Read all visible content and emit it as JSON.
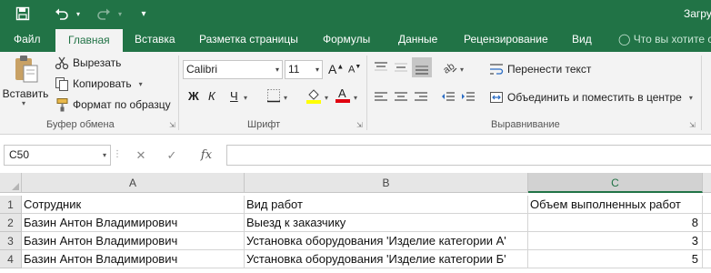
{
  "title_bar": {
    "doc_title": "Загру"
  },
  "ribbon_tabs": [
    {
      "label": "Файл"
    },
    {
      "label": "Главная"
    },
    {
      "label": "Вставка"
    },
    {
      "label": "Разметка страницы"
    },
    {
      "label": "Формулы"
    },
    {
      "label": "Данные"
    },
    {
      "label": "Рецензирование"
    },
    {
      "label": "Вид"
    }
  ],
  "tell_me": "Что вы хотите с",
  "clipboard": {
    "paste_label": "Вставить",
    "cut_label": "Вырезать",
    "copy_label": "Копировать",
    "format_painter_label": "Формат по образцу",
    "group_label": "Буфер обмена"
  },
  "font": {
    "font_name": "Calibri",
    "font_size": "11",
    "bold": "Ж",
    "italic": "К",
    "underline": "Ч",
    "group_label": "Шрифт",
    "fill_color": "#ffff00",
    "font_color": "#e0000f"
  },
  "alignment": {
    "wrap_text_label": "Перенести текст",
    "merge_label": "Объединить и поместить в центре",
    "group_label": "Выравнивание"
  },
  "formula_bar": {
    "name_box": "C50",
    "fx": "fx",
    "formula_value": ""
  },
  "sheet": {
    "columns": [
      "A",
      "B",
      "C"
    ],
    "selected_column": "C",
    "rows": [
      {
        "num": "1",
        "cells": [
          "Сотрудник",
          "Вид работ",
          "Объем выполненных работ"
        ]
      },
      {
        "num": "2",
        "cells": [
          "Базин Антон Владимирович",
          "Выезд к заказчику",
          "8"
        ]
      },
      {
        "num": "3",
        "cells": [
          "Базин Антон Владимирович",
          "Установка оборудования 'Изделие категории А'",
          "3"
        ]
      },
      {
        "num": "4",
        "cells": [
          "Базин Антон Владимирович",
          "Установка оборудования 'Изделие категории Б'",
          "5"
        ]
      }
    ]
  },
  "colors": {
    "brand": "#217346",
    "ribbon_bg": "#f3f3f3"
  }
}
